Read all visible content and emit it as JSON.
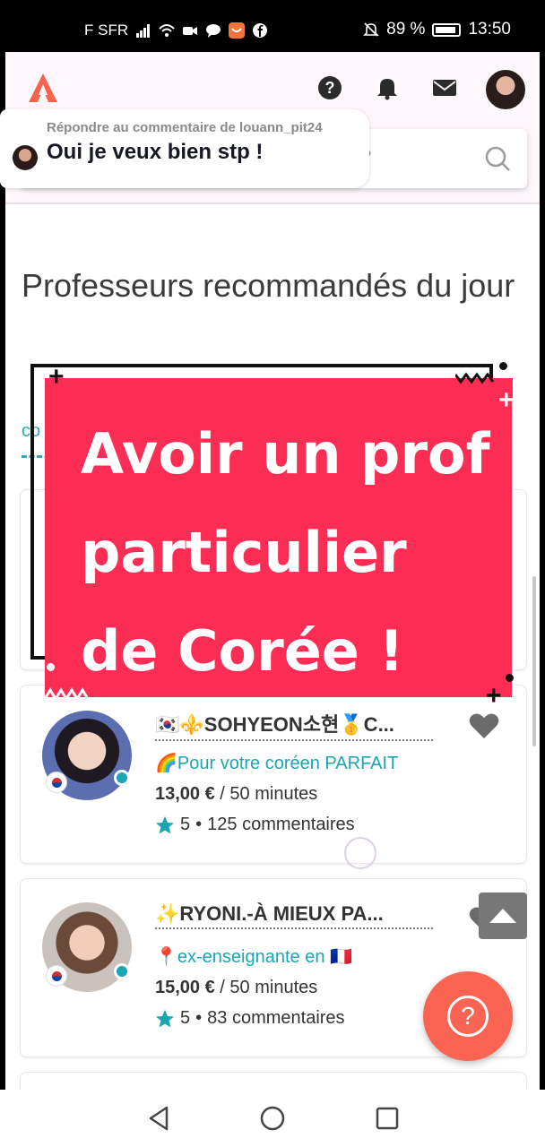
{
  "status_bar": {
    "carrier": "F SFR",
    "battery_percent": "89 %",
    "time": "13:50",
    "icons": [
      "signal-icon",
      "wifi-icon",
      "video-icon",
      "chat-icon",
      "shopping-app-icon",
      "facebook-icon",
      "mute-icon",
      "battery-icon"
    ]
  },
  "header": {
    "logo_icon": "italki-logo-icon",
    "icons": [
      "help-icon",
      "bell-icon",
      "mail-icon",
      "avatar"
    ]
  },
  "search": {
    "partial_placeholder": "?"
  },
  "reply_overlay": {
    "subtitle": "Répondre au commentaire de louann_pit24",
    "text": "Oui je veux bien stp !"
  },
  "section": {
    "title": "Professeurs recommandés du jour",
    "tab_hint": "co"
  },
  "promo_overlay": {
    "text": "Avoir un prof particulier de Corée !",
    "colors": {
      "background": "#fb2d55",
      "text": "#ffffff"
    }
  },
  "teachers": [
    {
      "name": "🇰🇷⚜️SOHYEON소현🥇C...",
      "tagline": "🌈Pour votre coréen PARFAIT",
      "price": "13,00 €",
      "duration": "/ 50 minutes",
      "rating": "5",
      "reviews": "125 commentaires"
    },
    {
      "name": "✨RYONI.-À MIEUX PA...",
      "tagline": "📍ex-enseignante en 🇫🇷",
      "price": "15,00 €",
      "duration": "/ 50 minutes",
      "rating": "5",
      "reviews": "83 commentaires"
    }
  ],
  "fab": {
    "label": "?",
    "color": "#fb6352"
  },
  "nav": {
    "icons": [
      "back-icon",
      "home-icon",
      "recents-icon"
    ]
  },
  "colors": {
    "accent": "#1aa5b3",
    "brand": "#fb6352"
  }
}
